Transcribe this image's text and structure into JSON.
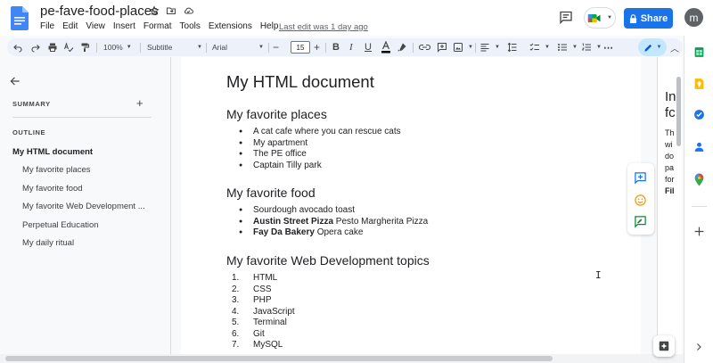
{
  "app": {
    "doc_title": "pe-fave-food-places",
    "last_edit": "Last edit was 1 day ago",
    "share_label": "Share",
    "avatar_initial": "m",
    "accent_color": "#1a73e8"
  },
  "menu": [
    "File",
    "Edit",
    "View",
    "Insert",
    "Format",
    "Tools",
    "Extensions",
    "Help"
  ],
  "toolbar": {
    "zoom": "100%",
    "style": "Subtitle",
    "font": "Arial",
    "font_size": "15"
  },
  "outline_panel": {
    "summary_label": "SUMMARY",
    "summary_add": "+",
    "outline_label": "OUTLINE",
    "items": [
      {
        "label": "My HTML document",
        "level": "main"
      },
      {
        "label": "My favorite places",
        "level": "sub"
      },
      {
        "label": "My favorite food",
        "level": "sub"
      },
      {
        "label": "My favorite Web Development ...",
        "level": "sub"
      },
      {
        "label": "Perpetual Education",
        "level": "sub"
      },
      {
        "label": "My daily ritual",
        "level": "sub"
      }
    ]
  },
  "document": {
    "title": "My HTML document",
    "sections": [
      {
        "heading": "My favorite places",
        "list_type": "bullets",
        "items": [
          {
            "bold": "",
            "text": "A cat cafe where you can rescue cats"
          },
          {
            "bold": "",
            "text": "My apartment"
          },
          {
            "bold": "",
            "text": "The PE office"
          },
          {
            "bold": "",
            "text": "Captain Tilly park"
          }
        ]
      },
      {
        "heading": "My favorite food",
        "list_type": "bullets",
        "items": [
          {
            "bold": "",
            "text": "Sourdough avocado toast"
          },
          {
            "bold": "Austin Street Pizza",
            "text": " Pesto Margherita Pizza"
          },
          {
            "bold": "Fay Da Bakery",
            "text": " Opera cake"
          }
        ]
      },
      {
        "heading": "My favorite Web Development topics",
        "list_type": "numbers",
        "items": [
          {
            "num": "1.",
            "bold": "",
            "text": "HTML"
          },
          {
            "num": "2.",
            "bold": "",
            "text": "CSS"
          },
          {
            "num": "3.",
            "bold": "",
            "text": "PHP"
          },
          {
            "num": "4.",
            "bold": "",
            "text": "JavaScript"
          },
          {
            "num": "5.",
            "bold": "",
            "text": "Terminal"
          },
          {
            "num": "6.",
            "bold": "",
            "text": "Git"
          },
          {
            "num": "7.",
            "bold": "",
            "text": "MySQL"
          }
        ]
      }
    ]
  },
  "right_page_fragments": {
    "heading_lines": [
      "In",
      "fc"
    ],
    "body_lines": [
      "Th",
      "wi",
      "do",
      "pa",
      "for"
    ],
    "bold_line": "Fil"
  }
}
